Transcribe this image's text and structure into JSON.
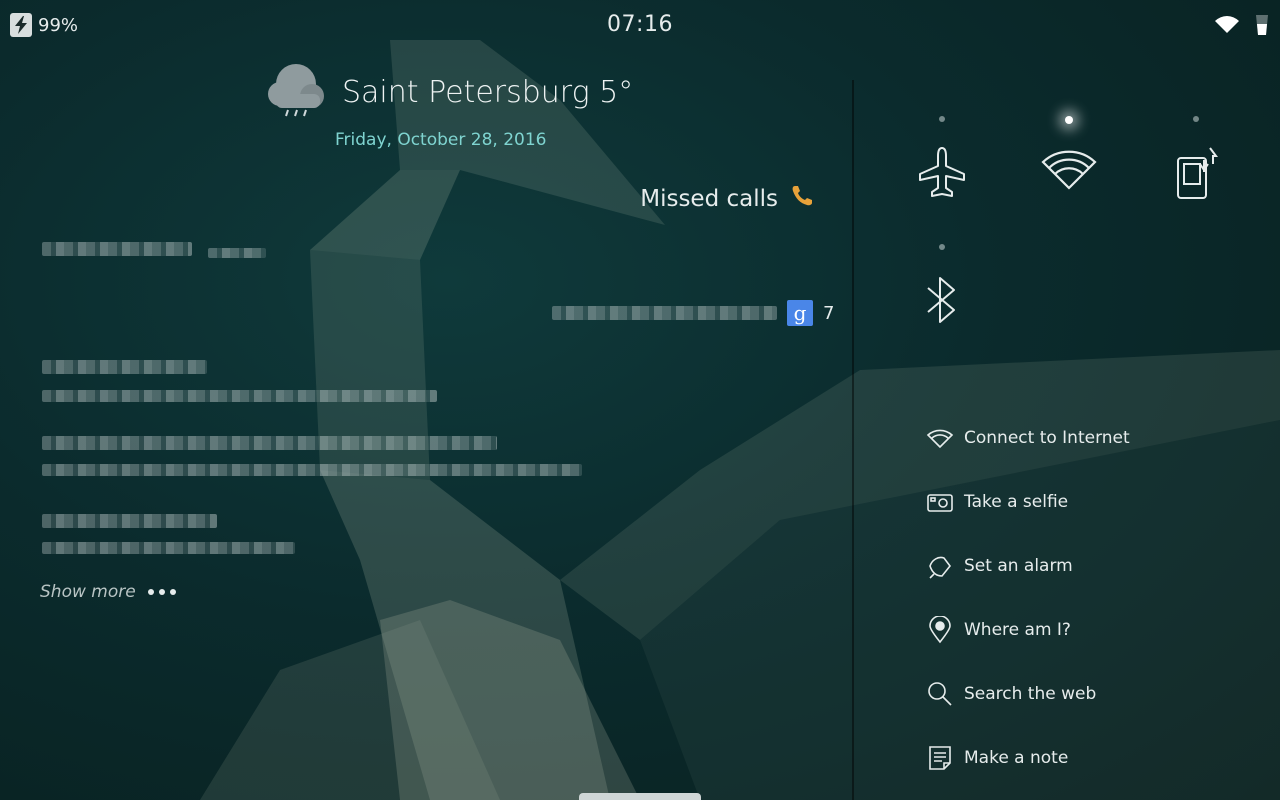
{
  "status": {
    "battery": "99%",
    "time": "07:16"
  },
  "weather": {
    "city": "Saint Petersburg 5°",
    "date": "Friday, October 28, 2016",
    "icon": "rain-cloud-icon"
  },
  "events": {
    "missed_calls": "Missed calls",
    "gmail_count": "7",
    "gmail_badge": "g",
    "show_more": "Show more"
  },
  "toggles": [
    {
      "name": "airplane-mode",
      "icon": "airplane-icon",
      "active": false
    },
    {
      "name": "wifi",
      "icon": "wifi-icon",
      "active": true
    },
    {
      "name": "mobile-data",
      "icon": "mobile-data-icon",
      "active": false
    },
    {
      "name": "bluetooth",
      "icon": "bluetooth-icon",
      "active": false
    }
  ],
  "shortcuts": [
    {
      "label": "Connect to Internet",
      "icon": "wifi-icon"
    },
    {
      "label": "Take a selfie",
      "icon": "camera-icon"
    },
    {
      "label": "Set an alarm",
      "icon": "alarm-bell-icon"
    },
    {
      "label": "Where am I?",
      "icon": "location-pin-icon"
    },
    {
      "label": "Search the web",
      "icon": "search-icon"
    },
    {
      "label": "Make a note",
      "icon": "note-icon"
    }
  ],
  "colors": {
    "accent": "#7fd4d0",
    "phone_icon": "#e8a23a",
    "gmail_badge": "#4a86e8"
  }
}
